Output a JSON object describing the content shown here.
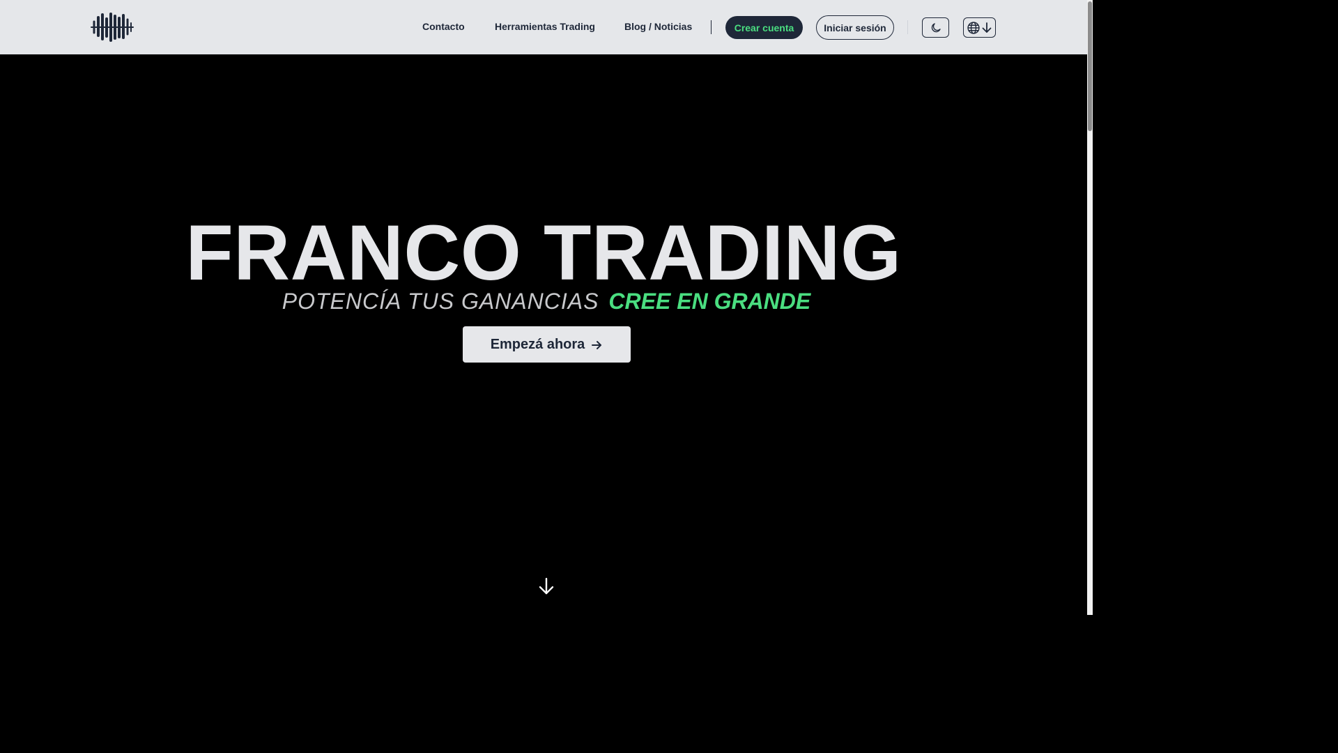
{
  "nav": {
    "links": [
      {
        "label": "Contacto"
      },
      {
        "label": "Herramientas Trading"
      },
      {
        "label": "Blog / Noticias"
      }
    ],
    "create_account": "Crear cuenta",
    "login": "Iniciar sesión",
    "theme_icon": "moon-icon",
    "language_icons": [
      "globe-icon",
      "arrow-down-icon"
    ]
  },
  "hero": {
    "title": "FRANCO TRADING",
    "tagline_light": "POTENCÍA TUS GANANCIAS",
    "tagline_accent": "CREE EN GRANDE",
    "cta_label": "Empezá ahora",
    "cta_icon": "arrow-right-icon",
    "scroll_icon": "arrow-down-icon"
  },
  "colors": {
    "navbar_bg": "#e5e7ea",
    "primary_dark": "#1e2738",
    "accent_green": "#4ade80",
    "hero_bg": "#000000",
    "hero_text": "#e6e7ea"
  }
}
